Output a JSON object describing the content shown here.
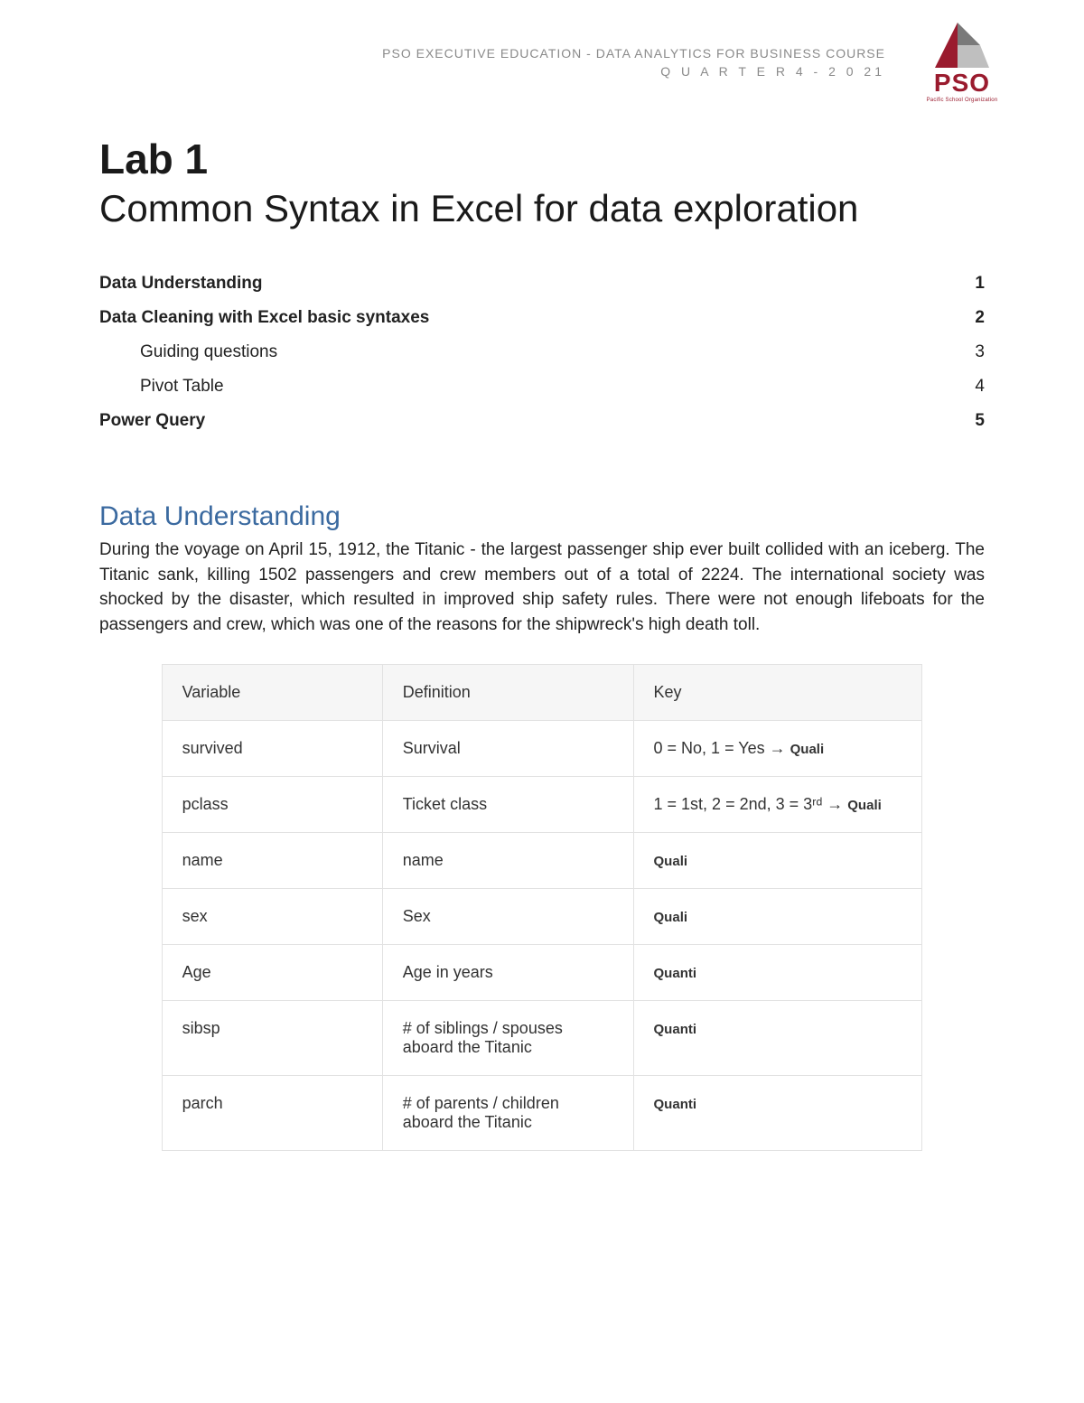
{
  "header": {
    "line1": "PSO EXECUTIVE EDUCATION - DATA ANALYTICS FOR BUSINESS  COURSE",
    "line2": "Q U A R T E R  4 - 2 0 21"
  },
  "logo": {
    "text": "PSO",
    "sub": "Pacific School Organization"
  },
  "title": {
    "lab": "Lab 1",
    "subtitle": "Common Syntax in Excel for data exploration"
  },
  "toc": [
    {
      "label": "Data Understanding",
      "page": "1",
      "bold": true,
      "indent": false
    },
    {
      "label": "Data Cleaning with Excel basic syntaxes",
      "page": "2",
      "bold": true,
      "indent": false
    },
    {
      "label": "Guiding questions",
      "page": "3",
      "bold": false,
      "indent": true
    },
    {
      "label": "Pivot Table",
      "page": "4",
      "bold": false,
      "indent": true
    },
    {
      "label": "Power Query",
      "page": "5",
      "bold": true,
      "indent": false
    }
  ],
  "section": {
    "heading": "Data Understanding",
    "paragraph": "During the voyage on April 15, 1912, the Titanic - the largest passenger ship ever built collided with an iceberg. The Titanic sank, killing 1502 passengers and crew members out of a total of 2224. The international society was shocked by the disaster, which resulted in improved ship safety rules. There were not enough lifeboats for the passengers and crew, which was one of the reasons for the shipwreck's high death toll."
  },
  "table": {
    "headers": [
      "Variable",
      "Definition",
      "Key"
    ],
    "rows": [
      {
        "var": "survived",
        "def": "Survival",
        "key_prefix": "0 = No, 1 = Yes → ",
        "key_tag": "Quali",
        "centered": false
      },
      {
        "var": "pclass",
        "def": "Ticket class",
        "key_prefix": "1 = 1st, 2 = 2nd, 3 = 3ʳᵈ → ",
        "key_tag": "Quali",
        "centered": false
      },
      {
        "var": "name",
        "def": "name",
        "key_prefix": "",
        "key_tag": "Quali",
        "centered": true
      },
      {
        "var": "sex",
        "def": "Sex",
        "key_prefix": "",
        "key_tag": "Quali",
        "centered": true
      },
      {
        "var": "Age",
        "def": "Age in years",
        "key_prefix": "",
        "key_tag": "Quanti",
        "centered": true
      },
      {
        "var": "sibsp",
        "def": "# of siblings / spouses aboard the Titanic",
        "key_prefix": "",
        "key_tag": "Quanti",
        "centered": true
      },
      {
        "var": "parch",
        "def": "# of parents / children aboard the Titanic",
        "key_prefix": "",
        "key_tag": "Quanti",
        "centered": true
      }
    ]
  }
}
